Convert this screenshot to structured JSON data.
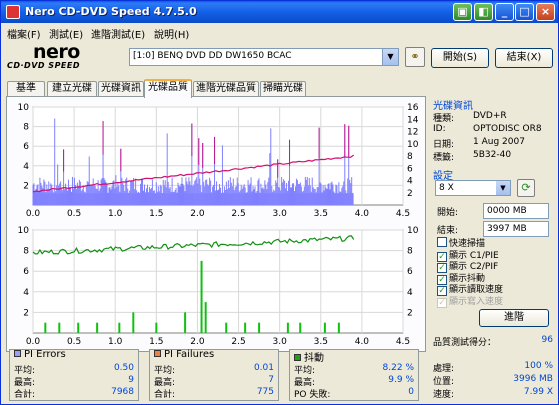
{
  "window": {
    "title": "Nero CD-DVD Speed 4.7.5.0"
  },
  "menu": [
    "檔案(F)",
    "測試(E)",
    "進階測試(E)",
    "說明(H)"
  ],
  "logo": {
    "brand": "nero",
    "product": "CD·DVD SPEED"
  },
  "drive": {
    "selected": "[1:0]   BENQ DVD DD DW1650 BCAC"
  },
  "buttons": {
    "start": "開始(S)",
    "exit": "結束(X)",
    "advanced": "進階"
  },
  "tabs": [
    "基準",
    "建立光碟",
    "光碟資訊",
    "光碟品質",
    "進階光碟品質",
    "掃瞄光碟"
  ],
  "active_tab": 3,
  "disc_info": {
    "title": "光碟資訊",
    "rows": [
      {
        "label": "種類:",
        "value": "DVD+R"
      },
      {
        "label": "ID:",
        "value": "OPTODISC OR8"
      },
      {
        "label": "日期:",
        "value": "1 Aug 2007"
      },
      {
        "label": "標籤:",
        "value": "5B32-40"
      }
    ]
  },
  "settings": {
    "title": "設定",
    "speed": "8 X",
    "start_label": "開始:",
    "start_value": "0000 MB",
    "end_label": "結束:",
    "end_value": "3997 MB",
    "checks": [
      {
        "label": "快速掃描",
        "checked": false,
        "disabled": false
      },
      {
        "label": "顯示 C1/PIE",
        "checked": true,
        "disabled": false
      },
      {
        "label": "顯示 C2/PIF",
        "checked": true,
        "disabled": false
      },
      {
        "label": "顯示抖動",
        "checked": true,
        "disabled": false
      },
      {
        "label": "顯示讀取速度",
        "checked": true,
        "disabled": false
      },
      {
        "label": "顯示寫入速度",
        "checked": true,
        "disabled": true
      }
    ]
  },
  "quality": {
    "label": "品質測試得分：",
    "value": "96"
  },
  "progress": {
    "rows": [
      {
        "label": "處理:",
        "value": "100 %"
      },
      {
        "label": "位置:",
        "value": "3996 MB"
      },
      {
        "label": "速度:",
        "value": "7.99 X"
      }
    ]
  },
  "stats": {
    "pi_errors": {
      "title": "PI Errors",
      "color": "#9d9dff",
      "rows": [
        {
          "label": "平均:",
          "value": "0.50"
        },
        {
          "label": "最高:",
          "value": "9"
        },
        {
          "label": "合計:",
          "value": "7968"
        }
      ]
    },
    "pi_failures": {
      "title": "PI Failures",
      "color": "#f08040",
      "rows": [
        {
          "label": "平均:",
          "value": "0.01"
        },
        {
          "label": "最高:",
          "value": "7"
        },
        {
          "label": "合計:",
          "value": "775"
        }
      ]
    },
    "jitter": {
      "title": "抖動",
      "color": "#20a020",
      "rows": [
        {
          "label": "平均:",
          "value": "8.22 %"
        },
        {
          "label": "最高:",
          "value": "9.9 %"
        },
        {
          "label": "PO 失敗:",
          "value": "0"
        }
      ]
    }
  },
  "chart_data": [
    {
      "type": "bar",
      "xlim": [
        0,
        4.5
      ],
      "ylim_left": [
        0,
        10
      ],
      "ylim_right": [
        0,
        16
      ],
      "x_ticks": [
        "0.0",
        "0.5",
        "1.0",
        "1.5",
        "2.0",
        "2.5",
        "3.0",
        "3.5",
        "4.0",
        "4.5"
      ],
      "y_ticks_left": [
        "10",
        "8",
        "6",
        "4",
        "2"
      ],
      "y_ticks_right": [
        "16",
        "14",
        "12",
        "10",
        "8",
        "6",
        "4",
        "2"
      ],
      "series": [
        {
          "name": "PI Errors",
          "x_range": [
            0,
            3.9
          ],
          "typical": 1.2,
          "max": 9
        },
        {
          "name": "讀取速度",
          "x": [
            0,
            3.9
          ],
          "y": [
            2.2,
            8.0
          ]
        }
      ]
    },
    {
      "type": "bar",
      "xlim": [
        0,
        4.5
      ],
      "ylim_left": [
        0,
        10
      ],
      "ylim_right": [
        0,
        10
      ],
      "x_ticks": [
        "0.0",
        "0.5",
        "1.0",
        "1.5",
        "2.0",
        "2.5",
        "3.0",
        "3.5",
        "4.0",
        "4.5"
      ],
      "y_ticks_left": [
        "10",
        "8",
        "6",
        "4",
        "2"
      ],
      "y_ticks_right": [
        "10",
        "8",
        "6",
        "4",
        "2"
      ],
      "series": [
        {
          "name": "PI Failures",
          "x": [
            0.15,
            0.32,
            0.55,
            0.78,
            1.05,
            1.22,
            1.5,
            1.85,
            2.05,
            2.1,
            2.35,
            2.58,
            2.75,
            3.1,
            3.25,
            3.55,
            3.72
          ],
          "y": [
            1,
            1,
            1,
            1,
            1,
            2,
            1,
            2,
            7,
            3,
            1,
            1,
            1,
            1,
            1,
            1,
            1
          ]
        },
        {
          "name": "抖動",
          "x": [
            0,
            3.9
          ],
          "y": [
            7.8,
            9.2
          ]
        }
      ]
    }
  ]
}
